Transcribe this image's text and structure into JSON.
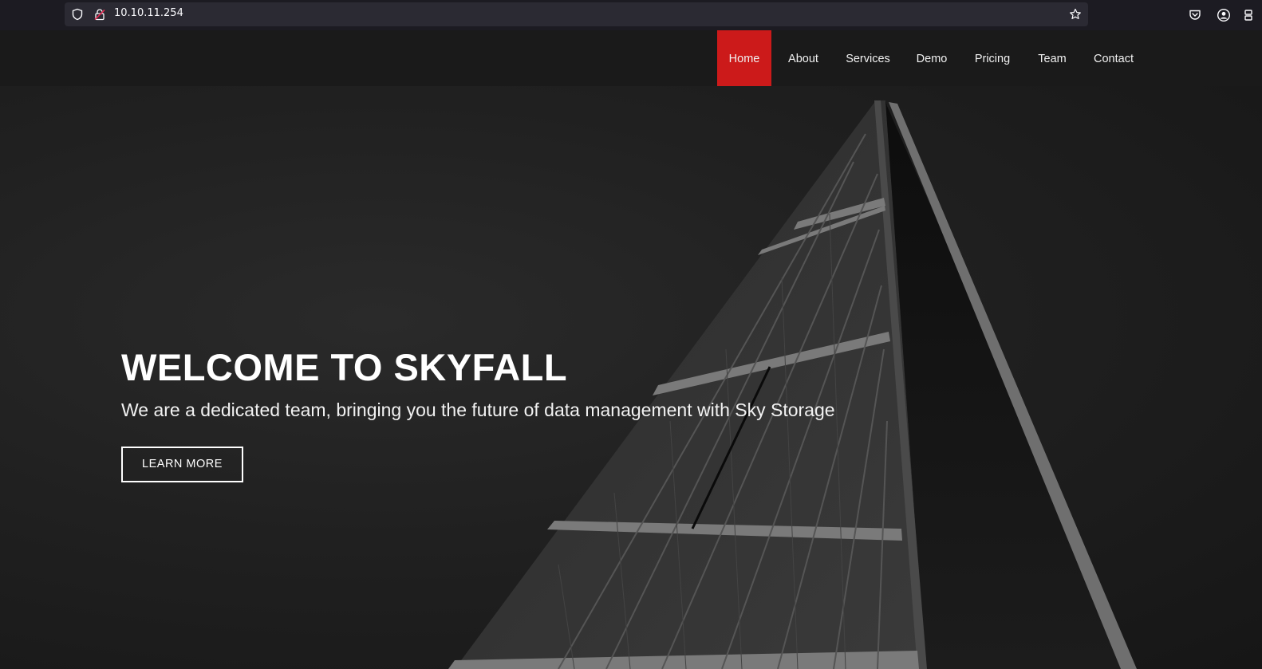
{
  "browser": {
    "url": "10.10.11.254"
  },
  "nav": {
    "items": [
      {
        "label": "Home",
        "active": true
      },
      {
        "label": "About"
      },
      {
        "label": "Services"
      },
      {
        "label": "Demo"
      },
      {
        "label": "Pricing"
      },
      {
        "label": "Team"
      },
      {
        "label": "Contact"
      }
    ]
  },
  "hero": {
    "title": "WELCOME TO SKYFALL",
    "subtitle": "We are a dedicated team, bringing you the future of data management with Sky Storage",
    "button_label": "LEARN MORE"
  },
  "colors": {
    "accent": "#cc1a1a",
    "nav_bg": "#1a1a1a",
    "hero_bg": "#202020"
  }
}
